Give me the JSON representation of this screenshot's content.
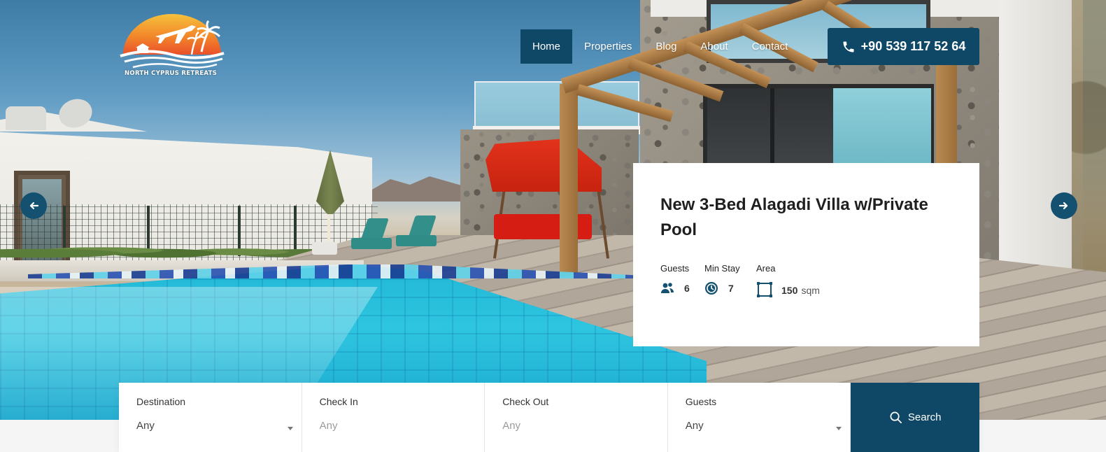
{
  "brand": {
    "logo_text": "NORTH CYPRUS RETREATS"
  },
  "nav": {
    "items": [
      {
        "label": "Home",
        "active": true
      },
      {
        "label": "Properties",
        "active": false
      },
      {
        "label": "Blog",
        "active": false
      },
      {
        "label": "About",
        "active": false
      },
      {
        "label": "Contact",
        "active": false
      }
    ]
  },
  "phone": {
    "label": "+90 539 117 52 64",
    "icon": "phone-icon"
  },
  "slider": {
    "prev_icon": "arrow-left-icon",
    "next_icon": "arrow-right-icon"
  },
  "property": {
    "title": "New 3-Bed Alagadi Villa w/Private Pool",
    "specs": {
      "guests": {
        "label": "Guests",
        "value": "6",
        "icon": "users-icon"
      },
      "min_stay": {
        "label": "Min Stay",
        "value": "7",
        "icon": "clock-icon"
      },
      "area": {
        "label": "Area",
        "value": "150",
        "unit": "sqm",
        "icon": "area-icon"
      }
    }
  },
  "search": {
    "destination": {
      "label": "Destination",
      "value": "Any"
    },
    "check_in": {
      "label": "Check In",
      "placeholder": "Any"
    },
    "check_out": {
      "label": "Check Out",
      "placeholder": "Any"
    },
    "guests": {
      "label": "Guests",
      "value": "Any"
    },
    "button_label": "Search",
    "button_icon": "search-icon"
  },
  "colors": {
    "primary": "#0f4766",
    "card_bg": "#ffffff",
    "logo_orange": "#f29a2e"
  }
}
